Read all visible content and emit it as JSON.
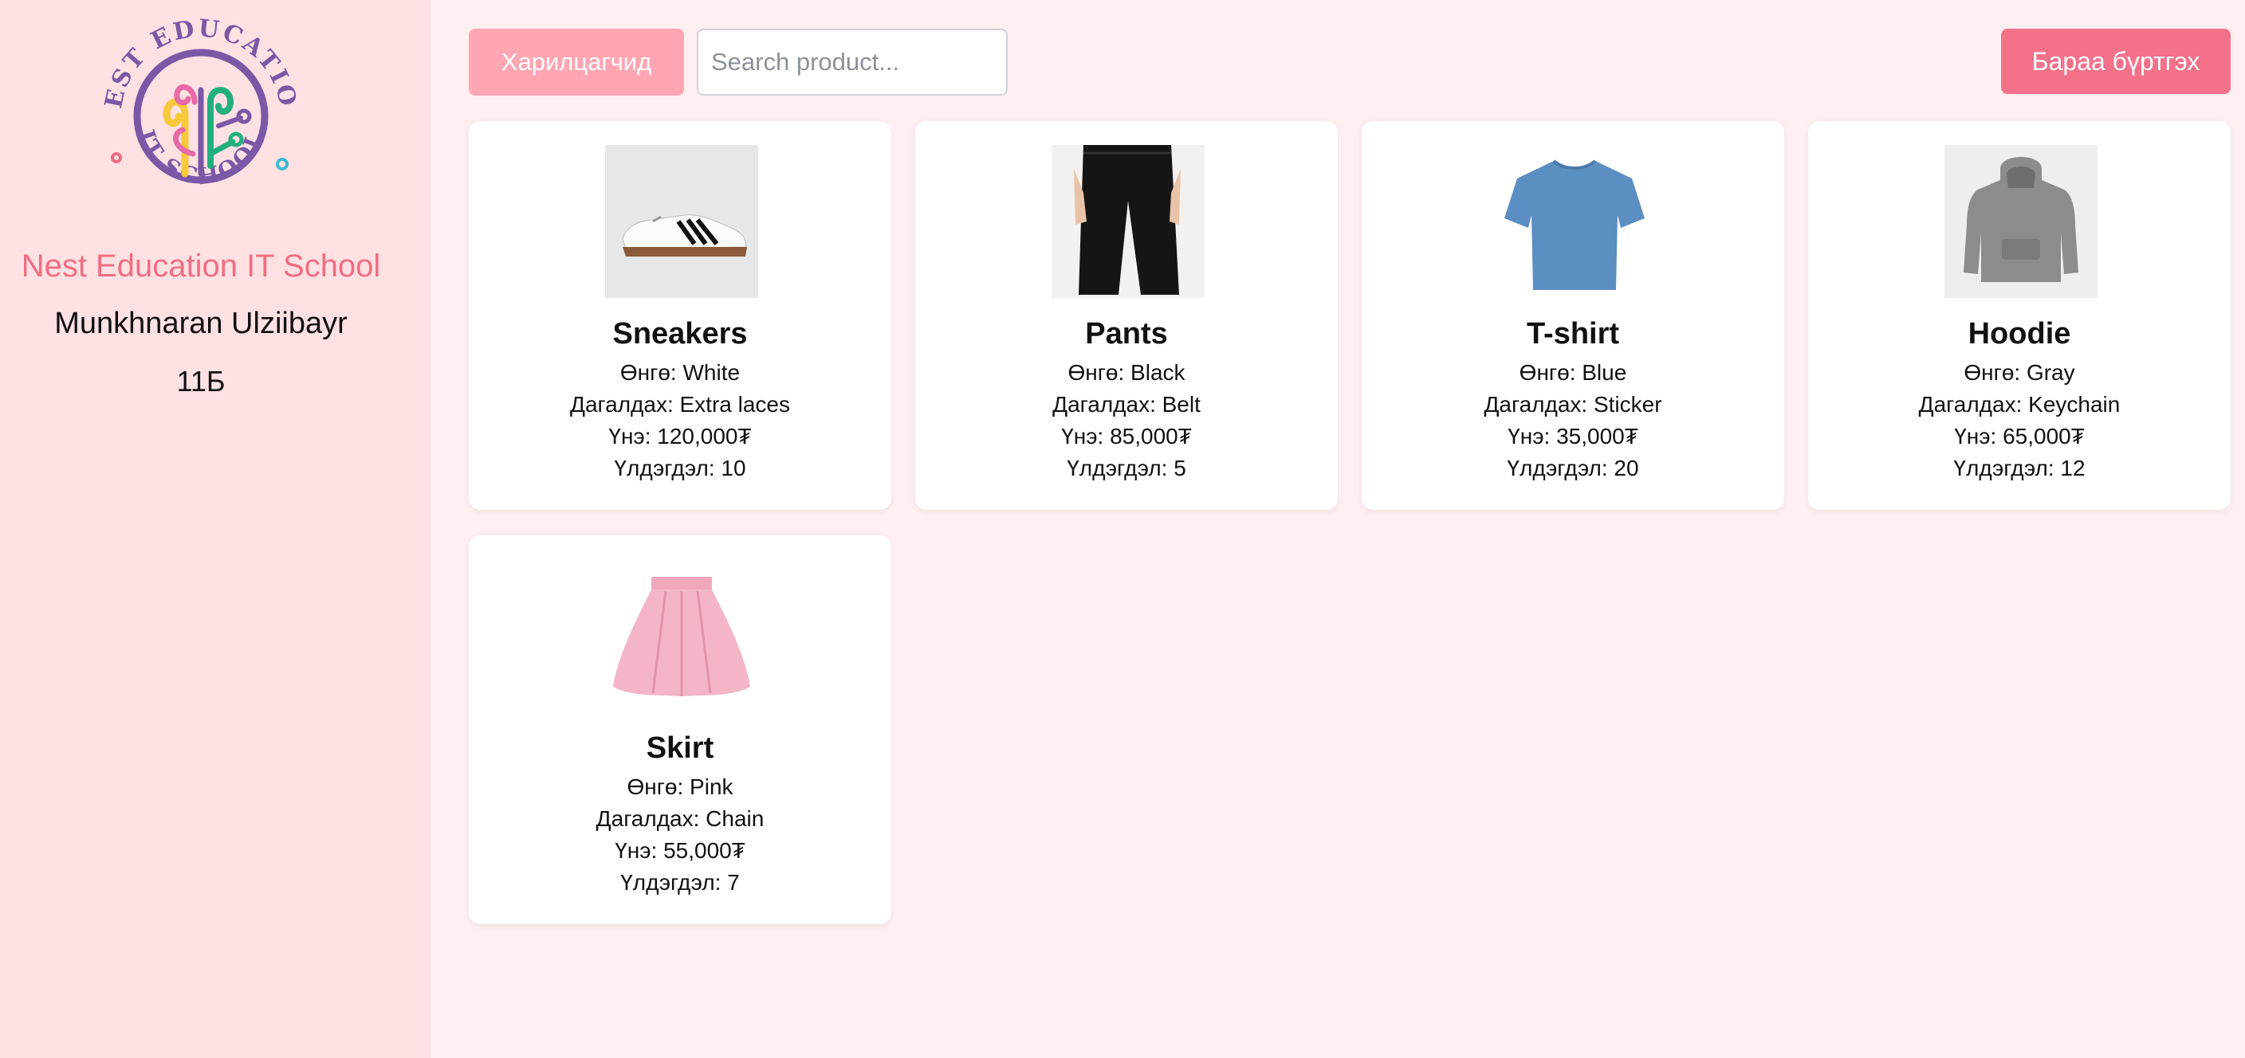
{
  "sidebar": {
    "logo": {
      "icon": "nest-education-logo",
      "text_top": "NEST EDUCATION",
      "text_bottom": "IT SCHOOL"
    },
    "school_name": "Nest Education IT School",
    "student_name": "Munkhnaran Ulziibayr",
    "student_class": "11Б"
  },
  "toolbar": {
    "customers_label": "Харилцагчид",
    "search_placeholder": "Search product...",
    "add_product_label": "Бараа бүртгэх"
  },
  "colors": {
    "accent": "#f4718a",
    "accent_light": "#ffa6b2",
    "sidebar_bg": "#ffe1e3",
    "page_bg": "#ffeff0"
  },
  "products": [
    {
      "name": "Sneakers",
      "color": "Өнгө: White",
      "accessory": "Дагалдах: Extra laces",
      "price": "Үнэ: 120,000₮",
      "stock": "Үлдэгдэл: 10",
      "image_icon": "sneakers-image"
    },
    {
      "name": "Pants",
      "color": "Өнгө: Black",
      "accessory": "Дагалдах: Belt",
      "price": "Үнэ: 85,000₮",
      "stock": "Үлдэгдэл: 5",
      "image_icon": "pants-image"
    },
    {
      "name": "T-shirt",
      "color": "Өнгө: Blue",
      "accessory": "Дагалдах: Sticker",
      "price": "Үнэ: 35,000₮",
      "stock": "Үлдэгдэл: 20",
      "image_icon": "tshirt-image"
    },
    {
      "name": "Hoodie",
      "color": "Өнгө: Gray",
      "accessory": "Дагалдах: Keychain",
      "price": "Үнэ: 65,000₮",
      "stock": "Үлдэгдэл: 12",
      "image_icon": "hoodie-image"
    },
    {
      "name": "Skirt",
      "color": "Өнгө: Pink",
      "accessory": "Дагалдах: Chain",
      "price": "Үнэ: 55,000₮",
      "stock": "Үлдэгдэл: 7",
      "image_icon": "skirt-image"
    }
  ]
}
